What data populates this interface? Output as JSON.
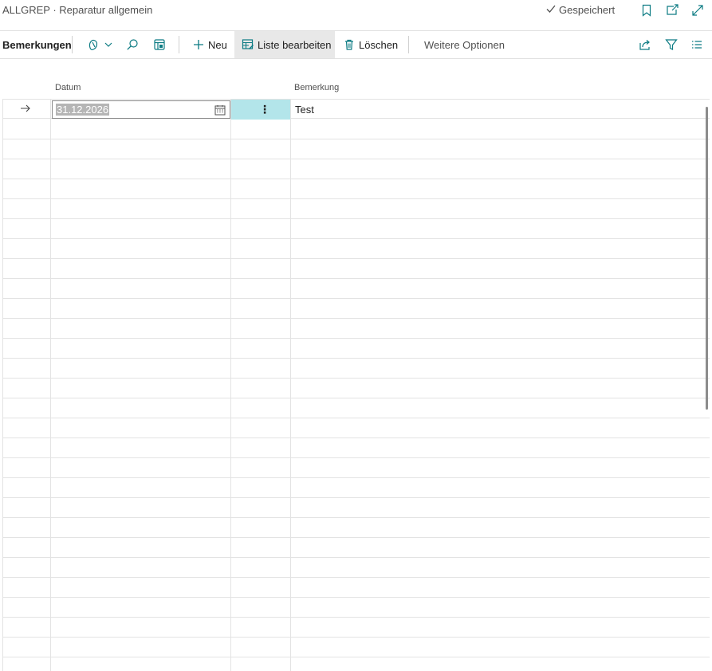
{
  "header": {
    "title": "ALLGREP · Reparatur allgemein",
    "saved_label": "Gespeichert",
    "icons": [
      "checkmark-icon",
      "bookmark-icon",
      "open-new-window-icon",
      "expand-icon"
    ]
  },
  "actionbar": {
    "page_title": "Bemerkungen",
    "new_label": "Neu",
    "edit_list_label": "Liste bearbeiten",
    "delete_label": "Löschen",
    "more_options_label": "Weitere Optionen",
    "icons": [
      "copilot-icon",
      "chevron-down-icon",
      "search-icon",
      "layout-icon",
      "plus-icon",
      "edit-list-icon",
      "trash-icon",
      "share-icon",
      "filter-icon",
      "list-view-icon"
    ]
  },
  "table": {
    "columns": [
      "Datum",
      "Bemerkung"
    ],
    "rows": [
      {
        "date": "31.12.2026",
        "remark": "Test"
      }
    ]
  },
  "colors": {
    "accent": "#b3e5ea",
    "active_button": "#e8e8e8",
    "icon_teal": "#0c7b83"
  }
}
